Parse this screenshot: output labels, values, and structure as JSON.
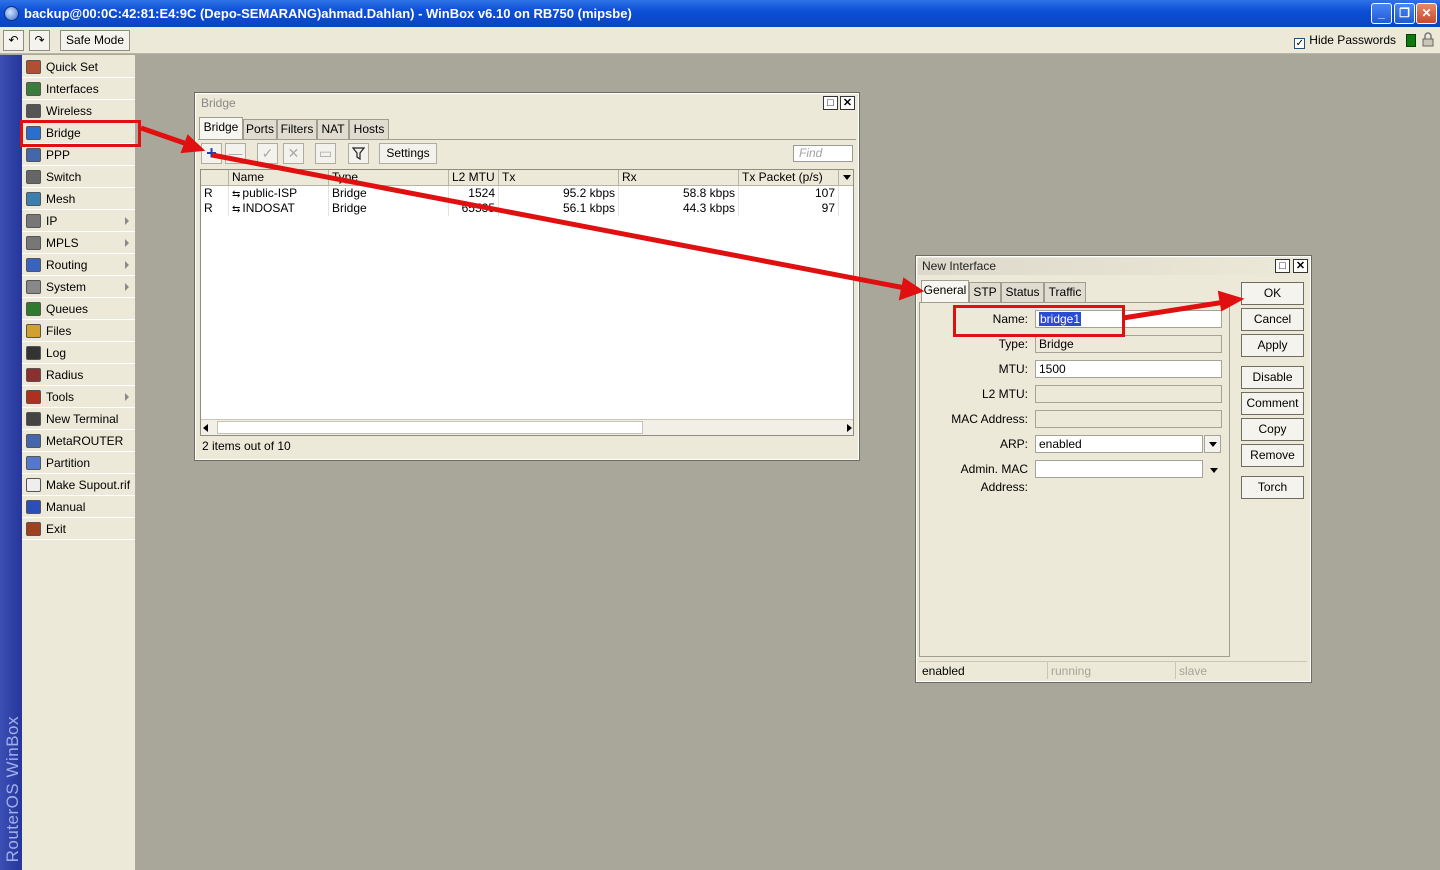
{
  "titlebar": {
    "title": "backup@00:0C:42:81:E4:9C (Depo-SEMARANG)ahmad.Dahlan) - WinBox v6.10 on RB750 (mipsbe)",
    "minimize": "_",
    "maximize": "❐",
    "close": "✕"
  },
  "toolbar": {
    "undo": "↶",
    "redo": "↷",
    "safe_mode": "Safe Mode",
    "hide_passwords": "Hide Passwords",
    "hide_passwords_checked": "✓"
  },
  "brand": "RouterOS WinBox",
  "menu": [
    {
      "label": "Quick Set",
      "icon": "quick-set-icon"
    },
    {
      "label": "Interfaces",
      "icon": "interfaces-icon"
    },
    {
      "label": "Wireless",
      "icon": "wireless-icon"
    },
    {
      "label": "Bridge",
      "icon": "bridge-icon"
    },
    {
      "label": "PPP",
      "icon": "ppp-icon"
    },
    {
      "label": "Switch",
      "icon": "switch-icon"
    },
    {
      "label": "Mesh",
      "icon": "mesh-icon"
    },
    {
      "label": "IP",
      "icon": "ip-icon",
      "submenu": true
    },
    {
      "label": "MPLS",
      "icon": "mpls-icon",
      "submenu": true
    },
    {
      "label": "Routing",
      "icon": "routing-icon",
      "submenu": true
    },
    {
      "label": "System",
      "icon": "system-icon",
      "submenu": true
    },
    {
      "label": "Queues",
      "icon": "queues-icon"
    },
    {
      "label": "Files",
      "icon": "files-icon"
    },
    {
      "label": "Log",
      "icon": "log-icon"
    },
    {
      "label": "Radius",
      "icon": "radius-icon"
    },
    {
      "label": "Tools",
      "icon": "tools-icon",
      "submenu": true
    },
    {
      "label": "New Terminal",
      "icon": "terminal-icon"
    },
    {
      "label": "MetaROUTER",
      "icon": "metarouter-icon"
    },
    {
      "label": "Partition",
      "icon": "partition-icon"
    },
    {
      "label": "Make Supout.rif",
      "icon": "supout-icon"
    },
    {
      "label": "Manual",
      "icon": "manual-icon"
    },
    {
      "label": "Exit",
      "icon": "exit-icon"
    }
  ],
  "bridge_window": {
    "title": "Bridge",
    "tabs": [
      "Bridge",
      "Ports",
      "Filters",
      "NAT",
      "Hosts"
    ],
    "add": "+",
    "remove": "—",
    "enable": "✓",
    "disable": "✕",
    "comment": "▭",
    "filter": "filter-icon",
    "settings": "Settings",
    "find_placeholder": "Find",
    "columns": [
      "Name",
      "Type",
      "L2 MTU",
      "Tx",
      "Rx",
      "Tx Packet (p/s)"
    ],
    "rows": [
      {
        "flag": "R",
        "name": "public-ISP",
        "type": "Bridge",
        "l2mtu": "1524",
        "tx": "95.2 kbps",
        "rx": "58.8 kbps",
        "txpps": "107"
      },
      {
        "flag": "R",
        "name": "INDOSAT",
        "type": "Bridge",
        "l2mtu": "65535",
        "tx": "56.1 kbps",
        "rx": "44.3 kbps",
        "txpps": "97"
      }
    ],
    "status": "2 items out of 10"
  },
  "new_interface": {
    "title": "New Interface",
    "tabs": [
      "General",
      "STP",
      "Status",
      "Traffic"
    ],
    "fields": {
      "name_label": "Name:",
      "name_value": "bridge1",
      "type_label": "Type:",
      "type_value": "Bridge",
      "mtu_label": "MTU:",
      "mtu_value": "1500",
      "l2mtu_label": "L2 MTU:",
      "l2mtu_value": "",
      "mac_label": "MAC Address:",
      "mac_value": "",
      "arp_label": "ARP:",
      "arp_value": "enabled",
      "admin_mac_label": "Admin. MAC Address:",
      "admin_mac_value": ""
    },
    "buttons": [
      "OK",
      "Cancel",
      "Apply",
      "Disable",
      "Comment",
      "Copy",
      "Remove",
      "Torch"
    ],
    "status": [
      "enabled",
      "running",
      "slave"
    ]
  },
  "colors": {
    "annotation": "#e01010",
    "titlebar": "#0d50d8"
  }
}
